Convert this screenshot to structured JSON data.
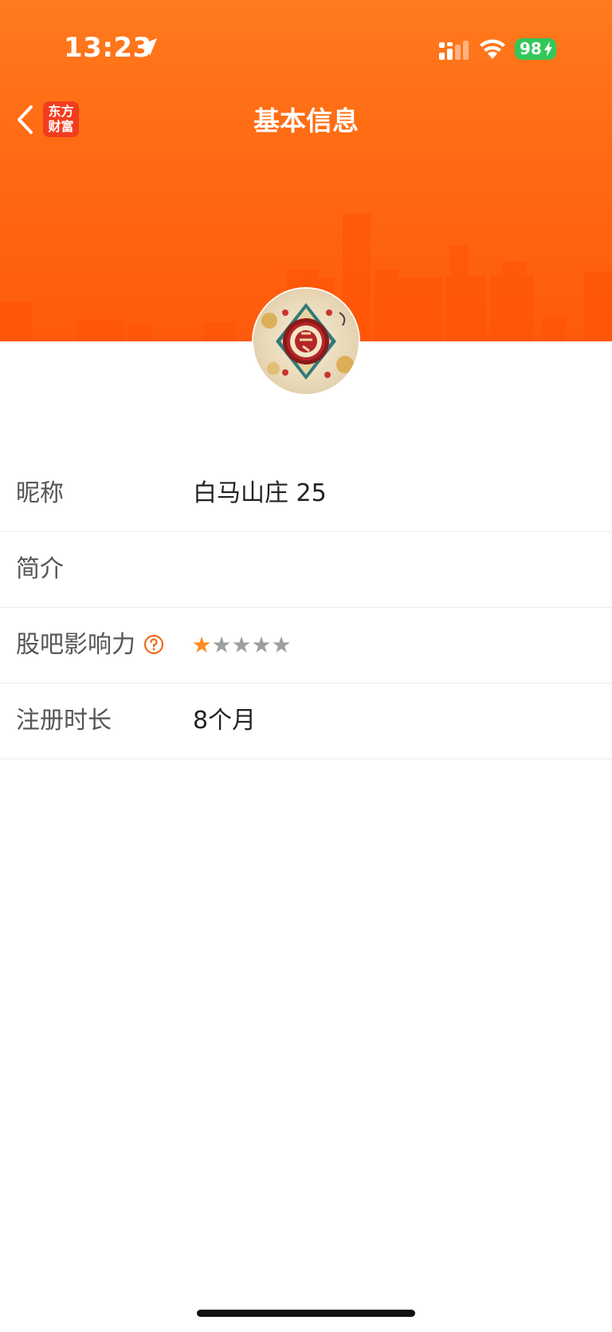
{
  "status_bar": {
    "time": "13:23",
    "battery_level": "98",
    "icons": [
      "location-icon",
      "signal-icon",
      "wifi-icon",
      "battery-icon"
    ]
  },
  "nav": {
    "title": "基本信息",
    "logo_line1": "东方",
    "logo_line2": "财富",
    "icons": [
      "back-icon"
    ]
  },
  "colors": {
    "brand_orange": "#ff6a12",
    "star_active": "#ff8a1f",
    "star_inactive": "#9e9e9e",
    "help_icon": "#f06a1a"
  },
  "profile": {
    "rows": [
      {
        "label": "昵称",
        "value": "白马山庄 25"
      },
      {
        "label": "简介",
        "value": ""
      },
      {
        "label": "股吧影响力",
        "value": "",
        "rating": 1,
        "rating_max": 5,
        "star_glyph": "★"
      },
      {
        "label": "注册时长",
        "value": "8个月"
      }
    ]
  }
}
